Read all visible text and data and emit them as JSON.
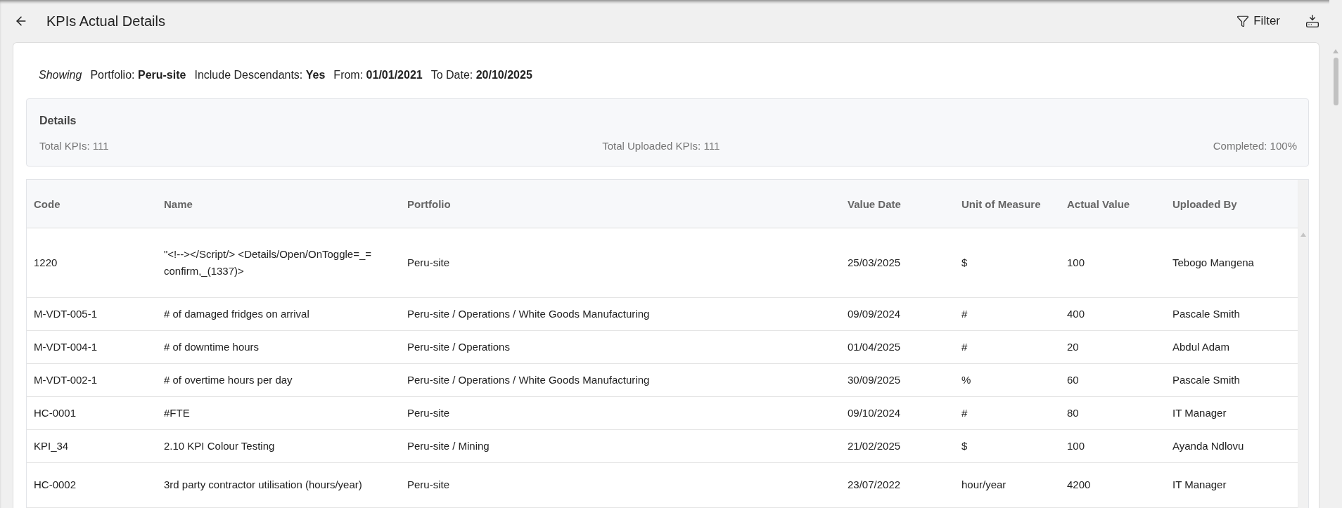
{
  "header": {
    "title": "KPIs Actual Details",
    "actions": [
      {
        "kind": "filter",
        "label": "Filter"
      },
      {
        "kind": "download"
      }
    ]
  },
  "showing": {
    "label": "Showing",
    "filters": [
      {
        "label": "Portfolio:",
        "value": "Peru-site"
      },
      {
        "label": "Include Descendants:",
        "value": "Yes"
      },
      {
        "label": "From:",
        "value": "01/01/2021"
      },
      {
        "label": "To Date:",
        "value": "20/10/2025"
      }
    ]
  },
  "details": {
    "title": "Details",
    "stats": [
      "Total KPIs: 111",
      "Total Uploaded KPIs: 111",
      "Completed: 100%"
    ]
  },
  "table": {
    "columns": [
      "Code",
      "Name",
      "Portfolio",
      "Value Date",
      "Unit of Measure",
      "Actual Value",
      "Uploaded By"
    ],
    "rows": [
      [
        "1220",
        "\"<!--></Script/> <Details/Open/OnToggle=_=confirm,_(1337)>",
        "Peru-site",
        "25/03/2025",
        "$",
        "100",
        "Tebogo Mangena"
      ],
      [
        "M-VDT-005-1",
        "# of damaged fridges on arrival",
        "Peru-site / Operations / White Goods Manufacturing",
        "09/09/2024",
        "#",
        "400",
        "Pascale Smith"
      ],
      [
        "M-VDT-004-1",
        "# of downtime hours",
        "Peru-site / Operations",
        "01/04/2025",
        "#",
        "20",
        "Abdul Adam"
      ],
      [
        "M-VDT-002-1",
        "# of overtime hours per day",
        "Peru-site / Operations / White Goods Manufacturing",
        "30/09/2025",
        "%",
        "60",
        "Pascale Smith"
      ],
      [
        "HC-0001",
        "#FTE",
        "Peru-site",
        "09/10/2024",
        "#",
        "80",
        "IT Manager"
      ],
      [
        "KPI_34",
        "2.10 KPI Colour Testing",
        "Peru-site / Mining",
        "21/02/2025",
        "$",
        "100",
        "Ayanda Ndlovu"
      ],
      [
        "HC-0002",
        "3rd party contractor utilisation (hours/year)",
        "Peru-site",
        "23/07/2022",
        "hour/year",
        "4200",
        "IT Manager"
      ]
    ]
  }
}
